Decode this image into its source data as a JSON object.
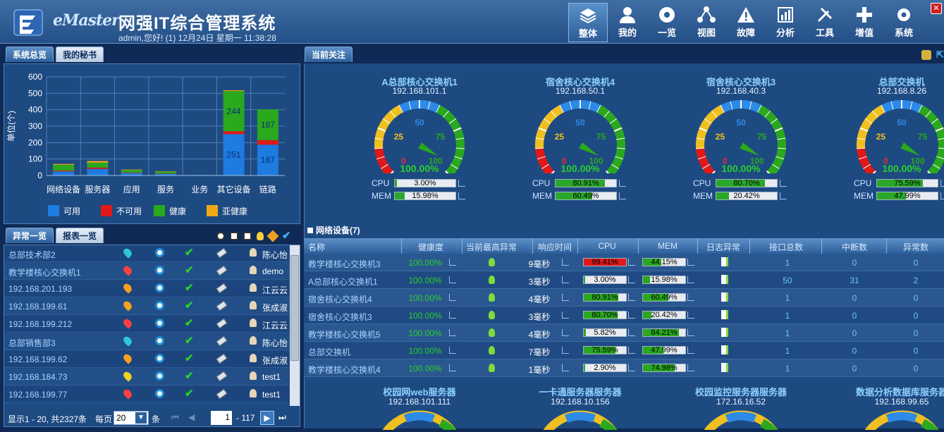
{
  "header": {
    "brand": "eMaster",
    "title": "网强IT综合管理系统",
    "user_info": "admin,您好! (1) 12月24日 星期一 11:38:28"
  },
  "nav": [
    {
      "label": "整体",
      "icon": "layers-icon"
    },
    {
      "label": "我的",
      "icon": "user-icon"
    },
    {
      "label": "一览",
      "icon": "overview-icon"
    },
    {
      "label": "视图",
      "icon": "topology-icon"
    },
    {
      "label": "故障",
      "icon": "warning-icon"
    },
    {
      "label": "分析",
      "icon": "analysis-chart-icon"
    },
    {
      "label": "工具",
      "icon": "tools-icon"
    },
    {
      "label": "增值",
      "icon": "plus-icon"
    },
    {
      "label": "系统",
      "icon": "gear-icon"
    }
  ],
  "left_tabs": [
    "系统总览",
    "我的秘书"
  ],
  "chart_data": {
    "type": "bar",
    "stacked": true,
    "ylabel": "单位(个)",
    "ylim": [
      0,
      600
    ],
    "yticks": [
      0,
      100,
      200,
      300,
      400,
      500,
      600
    ],
    "categories": [
      "网络设备",
      "服务器",
      "应用",
      "服务",
      "业务",
      "其它设备",
      "链路"
    ],
    "series": [
      {
        "name": "可用",
        "color": "#1e7be0",
        "values": [
          25,
          40,
          15,
          10,
          3,
          251,
          187
        ]
      },
      {
        "name": "不可用",
        "color": "#e01818",
        "values": [
          5,
          8,
          3,
          2,
          0,
          18,
          28
        ]
      },
      {
        "name": "健康",
        "color": "#2aa81e",
        "values": [
          35,
          30,
          15,
          12,
          0,
          244,
          187
        ]
      },
      {
        "name": "亚健康",
        "color": "#f0a818",
        "values": [
          5,
          10,
          3,
          2,
          0,
          5,
          0
        ]
      }
    ],
    "data_labels": [
      {
        "category": "其它设备",
        "series": "可用",
        "text": "251"
      },
      {
        "category": "其它设备",
        "series": "健康",
        "text": "244"
      },
      {
        "category": "链路",
        "series": "可用",
        "text": "187"
      },
      {
        "category": "链路",
        "series": "健康",
        "text": "187"
      }
    ]
  },
  "abn_tabs": [
    "异常一览",
    "报表一览"
  ],
  "abnormal": [
    {
      "name": "总部技术部2",
      "pin": "#2ec7d8",
      "user": "陈心怡"
    },
    {
      "name": "教学楼核心交换机1",
      "pin": "#ff4040",
      "user": "demo"
    },
    {
      "name": "192.168.201.193",
      "pin": "#f7a020",
      "user": "江云云"
    },
    {
      "name": "192.168.199.61",
      "pin": "#f7a020",
      "user": "张成淑"
    },
    {
      "name": "192.168.199.212",
      "pin": "#ff4040",
      "user": "江云云"
    },
    {
      "name": "总部销售部3",
      "pin": "#2ec7d8",
      "user": "陈心怡"
    },
    {
      "name": "192.168.199.62",
      "pin": "#f7a020",
      "user": "张成淑"
    },
    {
      "name": "192.168.184.73",
      "pin": "#f0d020",
      "user": "test1"
    },
    {
      "name": "192.168.199.77",
      "pin": "#ff4040",
      "user": "test1"
    }
  ],
  "pager": {
    "summary": "显示1 - 20, 共2327条",
    "per_page_label": "每页",
    "per_page": "20",
    "unit": "条",
    "page": "1",
    "total_pages": "- 117"
  },
  "right_tab": "当前关注",
  "gauges": [
    {
      "title": "A总部核心交换机1",
      "ip": "192.168.101.1",
      "health": "100.00%",
      "cpu": "3.00%",
      "cpu_val": 3.0,
      "mem": "15.98%",
      "mem_val": 15.98
    },
    {
      "title": "宿舍核心交换机4",
      "ip": "192.168.50.1",
      "health": "100.00%",
      "cpu": "80.91%",
      "cpu_val": 80.91,
      "mem": "60.49%",
      "mem_val": 60.49
    },
    {
      "title": "宿舍核心交换机3",
      "ip": "192.168.40.3",
      "health": "100.00%",
      "cpu": "80.70%",
      "cpu_val": 80.7,
      "mem": "20.42%",
      "mem_val": 20.42
    },
    {
      "title": "总部交换机",
      "ip": "192.168.8.26",
      "health": "100.00%",
      "cpu": "75.59%",
      "cpu_val": 75.59,
      "mem": "47.99%",
      "mem_val": 47.99
    }
  ],
  "gauge_ticks": {
    "t0": "0",
    "t25": "25",
    "t50": "50",
    "t75": "75",
    "t100": "100"
  },
  "cpu_label": "CPU",
  "mem_label": "MEM",
  "net_title": "网络设备(7)",
  "table_headers": [
    "名称",
    "健康度",
    "当前最高异常",
    "响应时间",
    "CPU",
    "MEM",
    "日志异常",
    "接口总数",
    "中断数",
    "异常数"
  ],
  "devices": [
    {
      "name": "教学楼核心交换机3",
      "health": "100.00%",
      "resp": "9毫秒",
      "cpu": "99.41%",
      "cpu_val": 99.41,
      "mem": "44.15%",
      "mem_val": 44.15,
      "ports": "1",
      "down": "0",
      "abn": "0"
    },
    {
      "name": "A总部核心交换机1",
      "health": "100.00%",
      "resp": "3毫秒",
      "cpu": "3.00%",
      "cpu_val": 3.0,
      "mem": "15.98%",
      "mem_val": 15.98,
      "ports": "50",
      "down": "31",
      "abn": "2"
    },
    {
      "name": "宿舍核心交换机4",
      "health": "100.00%",
      "resp": "4毫秒",
      "cpu": "80.91%",
      "cpu_val": 80.91,
      "mem": "60.49%",
      "mem_val": 60.49,
      "ports": "1",
      "down": "0",
      "abn": "0"
    },
    {
      "name": "宿舍核心交换机3",
      "health": "100.00%",
      "resp": "3毫秒",
      "cpu": "80.70%",
      "cpu_val": 80.7,
      "mem": "20.42%",
      "mem_val": 20.42,
      "ports": "1",
      "down": "0",
      "abn": "0"
    },
    {
      "name": "教学楼核心交换机5",
      "health": "100.00%",
      "resp": "4毫秒",
      "cpu": "5.82%",
      "cpu_val": 5.82,
      "mem": "84.21%",
      "mem_val": 84.21,
      "ports": "1",
      "down": "0",
      "abn": "0"
    },
    {
      "name": "总部交换机",
      "health": "100.00%",
      "resp": "7毫秒",
      "cpu": "75.59%",
      "cpu_val": 75.59,
      "mem": "47.99%",
      "mem_val": 47.99,
      "ports": "1",
      "down": "0",
      "abn": "0"
    },
    {
      "name": "教学楼核心交换机4",
      "health": "100.00%",
      "resp": "1毫秒",
      "cpu": "2.90%",
      "cpu_val": 2.9,
      "mem": "74.98%",
      "mem_val": 74.98,
      "ports": "1",
      "down": "0",
      "abn": "0"
    }
  ],
  "servers": [
    {
      "title": "校园网web服务器",
      "ip": "192.168.101.111"
    },
    {
      "title": "一卡通服务器服务器",
      "ip": "192.168.10.156"
    },
    {
      "title": "校园监控服务器服务器",
      "ip": "172.16.16.52"
    },
    {
      "title": "数据分析数据库服务器",
      "ip": "192.168.99.65"
    }
  ]
}
